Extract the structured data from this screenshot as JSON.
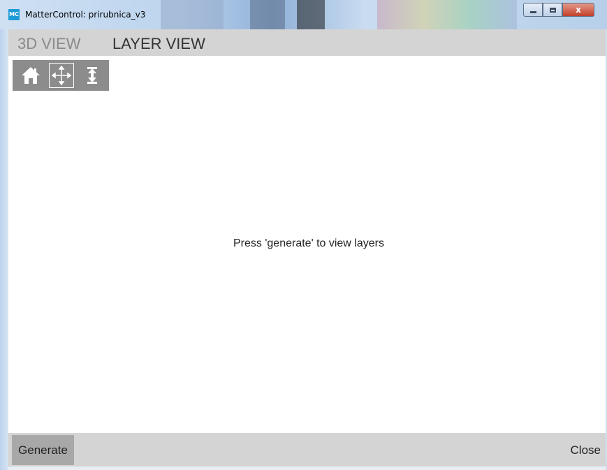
{
  "window": {
    "app_icon_text": "MC",
    "title": "MatterControl: prirubnica_v3",
    "close_glyph": "x"
  },
  "tabs": [
    {
      "label": "3D VIEW",
      "active": false
    },
    {
      "label": "LAYER VIEW",
      "active": true
    }
  ],
  "toolbar": {
    "tools": [
      "home-icon",
      "move-arrows-icon",
      "zoom-updown-icon"
    ],
    "selected": "move-arrows-icon"
  },
  "viewport": {
    "message": "Press 'generate' to view layers"
  },
  "footer": {
    "generate_label": "Generate",
    "close_label": "Close"
  },
  "colors": {
    "tab_bar": "#d4d4d4",
    "toolbar": "#8c8c8c",
    "generate_button": "#a8a8a8",
    "app_icon": "#1d9bd6"
  }
}
